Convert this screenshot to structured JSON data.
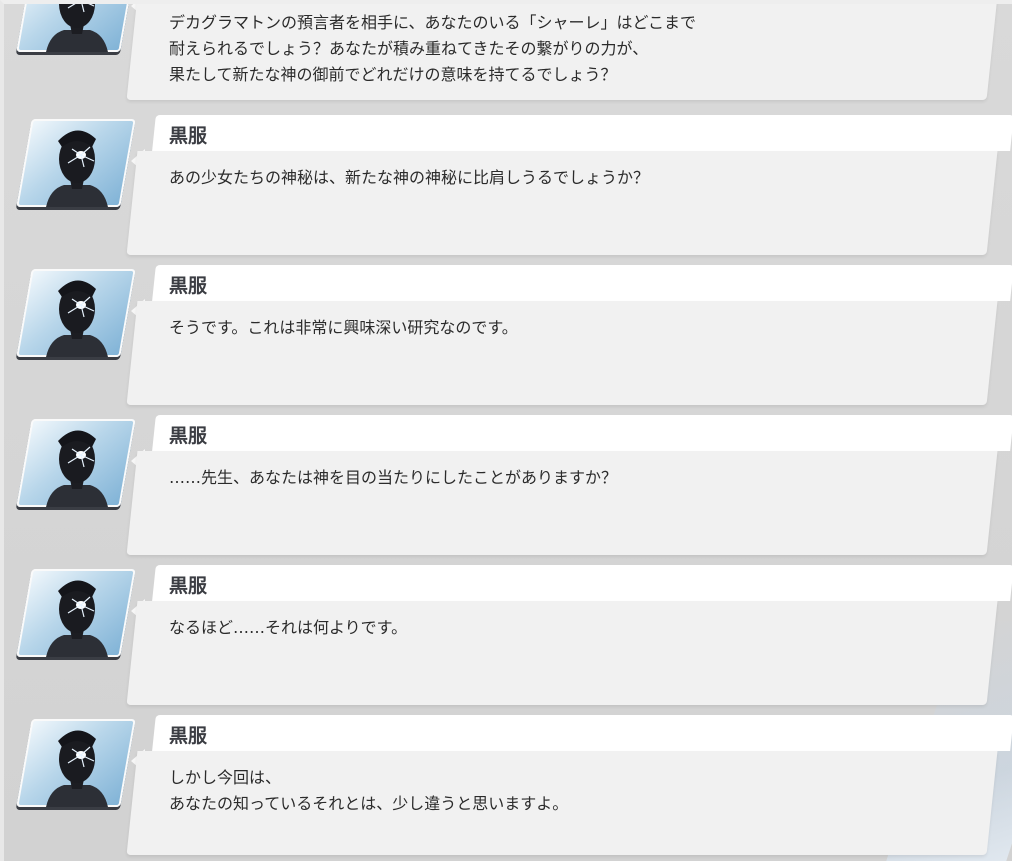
{
  "entries": [
    {
      "speaker": "",
      "lines": [
        "デカグラマトンの預言者を相手に、あなたのいる「シャーレ」はどこまで",
        "耐えられるでしょう？あなたが積み重ねてきたその繋がりの力が、",
        "果たして新たな神の御前でどれだけの意味を持てるでしょう？"
      ]
    },
    {
      "speaker": "黒服",
      "lines": [
        "あの少女たちの神秘は、新たな神の神秘に比肩しうるでしょうか？"
      ]
    },
    {
      "speaker": "黒服",
      "lines": [
        "そうです。これは非常に興味深い研究なのです。"
      ]
    },
    {
      "speaker": "黒服",
      "lines": [
        "……先生、あなたは神を目の当たりにしたことがありますか？"
      ]
    },
    {
      "speaker": "黒服",
      "lines": [
        "なるほど……それは何よりです。"
      ]
    },
    {
      "speaker": "黒服",
      "lines": [
        "しかし今回は、",
        "あなたの知っているそれとは、少し違うと思いますよ。"
      ]
    }
  ],
  "colors": {
    "background": "#d4d4d4",
    "bubble": "#f1f1f1",
    "name_tab": "#ffffff",
    "portrait_sky": "#b8d6ea"
  },
  "icons": {
    "portrait": "kurofuku-portrait"
  }
}
